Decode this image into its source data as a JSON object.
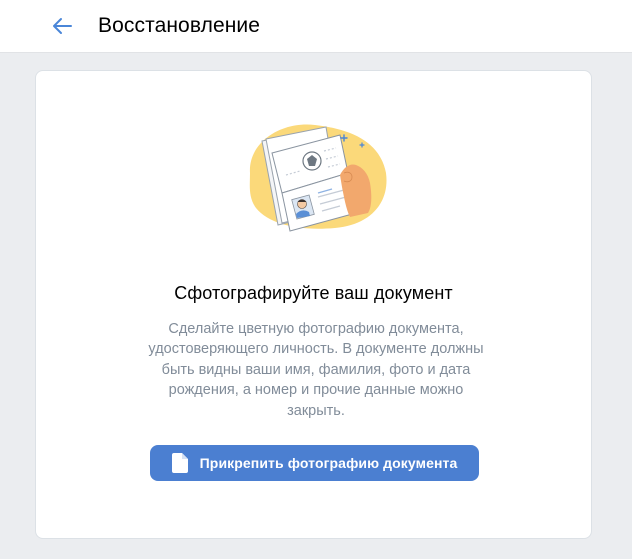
{
  "header": {
    "back_icon": "arrow-left-icon",
    "title": "Восстановление"
  },
  "main": {
    "illustration": "passport-in-hand-illustration",
    "heading": "Сфотографируйте ваш документ",
    "description": "Сделайте цветную фотографию документа, удостоверяющего личность. В документе должны быть видны ваши имя, фамилия, фото и дата рождения, а номер и прочие данные можно закрыть.",
    "attach_button": {
      "label": "Прикрепить фотографию документа",
      "icon": "document-icon"
    }
  },
  "colors": {
    "accent": "#4b7fd1",
    "back_arrow": "#4a86d8",
    "background": "#ebedf0",
    "card": "#ffffff",
    "secondary_text": "#818c99",
    "illustration_blob": "#fbd97a"
  }
}
